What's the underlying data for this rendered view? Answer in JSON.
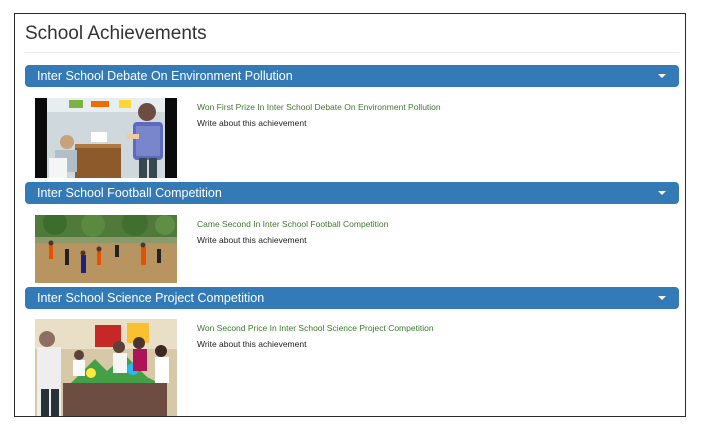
{
  "page": {
    "title": "School Achievements"
  },
  "achievements": [
    {
      "header": "Inter School Debate On Environment Pollution",
      "title": "Won First Prize In Inter School Debate On Environment Pollution",
      "description": "Write about this achievement",
      "image_icon": "debate-photo"
    },
    {
      "header": "Inter School Football Competition",
      "title": "Came Second In Inter School Football Competition",
      "description": "Write about this achievement",
      "image_icon": "football-photo"
    },
    {
      "header": "Inter School Science Project Competition",
      "title": "Won Second Price In Inter School Science Project Competition",
      "description": "Write about this achievement",
      "image_icon": "science-project-photo"
    }
  ],
  "colors": {
    "accordion_header": "#337ab7",
    "achievement_title": "#3c7a2e"
  },
  "icons": {
    "expand": "chevron-down-icon"
  }
}
